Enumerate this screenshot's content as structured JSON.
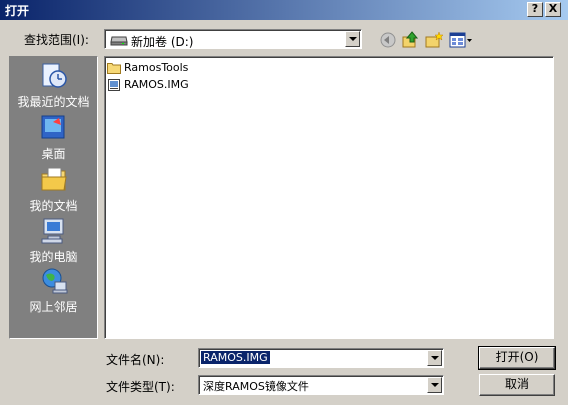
{
  "window": {
    "title": "打开",
    "help_btn": "?",
    "close_btn": "X"
  },
  "lookin": {
    "label": "查找范围(I):",
    "value": "新加卷 (D:)"
  },
  "places": [
    {
      "label": "我最近的文档",
      "icon": "recent-documents-icon"
    },
    {
      "label": "桌面",
      "icon": "desktop-icon"
    },
    {
      "label": "我的文档",
      "icon": "my-documents-icon"
    },
    {
      "label": "我的电脑",
      "icon": "my-computer-icon"
    },
    {
      "label": "网上邻居",
      "icon": "network-places-icon"
    }
  ],
  "files": [
    {
      "name": "RamosTools",
      "icon": "folder-icon"
    },
    {
      "name": "RAMOS.IMG",
      "icon": "image-file-icon"
    }
  ],
  "filename": {
    "label": "文件名(N):",
    "value": "RAMOS.IMG"
  },
  "filetype": {
    "label": "文件类型(T):",
    "value": "深度RAMOS镜像文件"
  },
  "buttons": {
    "open": "打开(O)",
    "cancel": "取消"
  },
  "colors": {
    "titlebar": "#0a246a",
    "places_bg": "#808080",
    "dialog_bg": "#d4d0c8"
  }
}
